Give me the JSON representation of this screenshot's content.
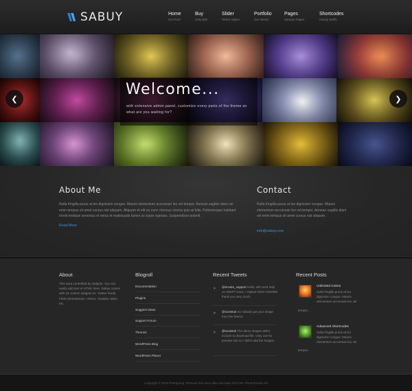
{
  "brand": {
    "name": "SABUY"
  },
  "nav": [
    {
      "label": "Home",
      "sub": "Go Front"
    },
    {
      "label": "Buy",
      "sub": "Only $35"
    },
    {
      "label": "Slider",
      "sub": "Select Styles"
    },
    {
      "label": "Portfolio",
      "sub": "Our Works"
    },
    {
      "label": "Pages",
      "sub": "Sample Pages"
    },
    {
      "label": "Shortcodes",
      "sub": "Handy Stuffs"
    }
  ],
  "slider": {
    "title": "Welcome...",
    "text": "with extensive admin panel, customize every parts of the theme so what are you waiting for?",
    "prev_icon": "arrow-left-icon",
    "next_icon": "arrow-right-icon"
  },
  "about_me": {
    "title": "About Me",
    "text": "Nulla fringilla purus at leo dignissim congue. Mauris elementum accumsan leo vel tempor. Aenean sagittis diam vel enim tempus sit amet cursus nisl aliquam. Aliquam et elit eu nunc rhoncus viverra quis at felis. Pellentesque habitant morbi tristique senectus et netus et malesuada fames ac turpis egestas. Suspendisse potenti.",
    "link": "Read More"
  },
  "contact": {
    "title": "Contact",
    "text": "Nulla fringilla purus at leo dignissim congue. Mauris elementum accumsan leo vel tempor. Aenean sagittis diam vel enim tempus sit amet cursus nisl aliquam.",
    "email": "info@sabuy.com"
  },
  "footer_about": {
    "title": "About",
    "text": "This area controlled by widgets. You can easily add text or HTML here. Sabuy comes with 16 custom widgets ex. Twitter feeds, Flickr photostream, Vimeo, Youtube video etc."
  },
  "blogroll": {
    "title": "Blogroll",
    "items": [
      "Documentation",
      "Plugins",
      "Suggest Ideas",
      "Support Forum",
      "Themes",
      "WordPress Blog",
      "WordPress Planet"
    ]
  },
  "tweets": {
    "title": "Recent Tweets",
    "items": [
      {
        "user": "@envato_support",
        "text": " Hello, still need help on SWIFT issue. I replied ticket #251965 thank you very much."
      },
      {
        "user": "@sovietuk",
        "text": " So nobody got your image from the theme."
      },
      {
        "user": "@sovietuk",
        "text": " The demo images didn't include to download file. Only use for preview site so I didn't add the images."
      }
    ]
  },
  "posts": {
    "title": "Recent Posts",
    "items": [
      {
        "title": "Unlimited Colors",
        "text": "Sulla fringilla purus at leo dignissim congue. Mauris elementum accumsan leo vel",
        "tail": "tempor..."
      },
      {
        "title": "Advanced Shortcodes",
        "text": "Sulla fringilla purus at leo dignissim congue. Mauris elementum accumsan leo vel",
        "tail": "tempor..."
      }
    ]
  },
  "copyright": "Copyright © 2010 Peerapong. Remove this once after purchase from the ThemeForest.net"
}
